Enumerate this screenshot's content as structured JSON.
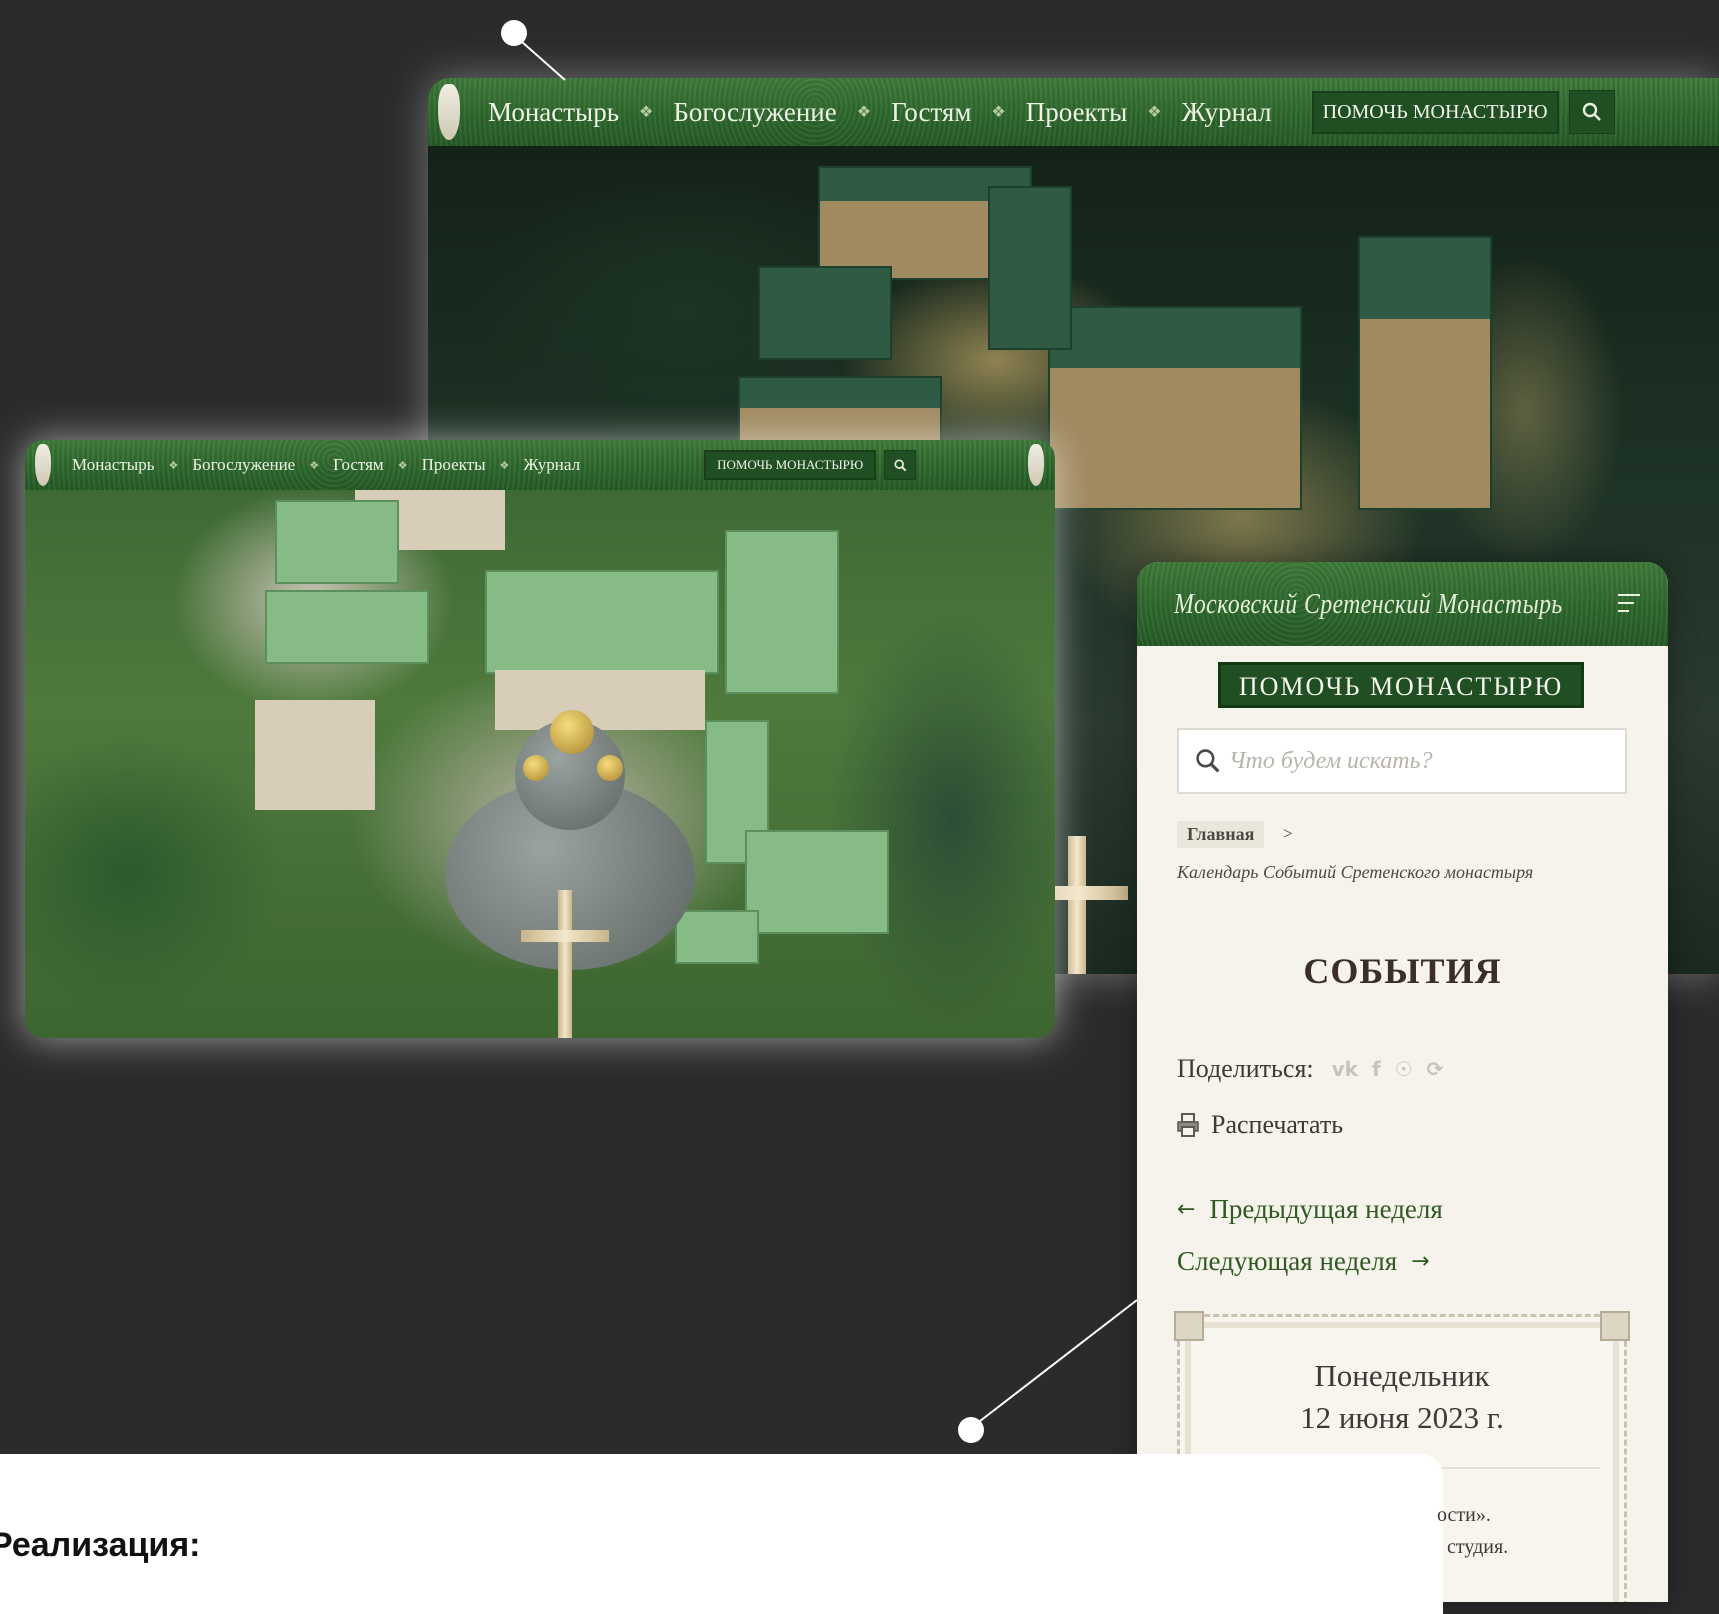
{
  "desktop_nav": {
    "items": [
      "Монастырь",
      "Богослужение",
      "Гостям",
      "Проекты",
      "Журнал"
    ],
    "help_label": "ПОМОЧЬ МОНАСТЫРЮ"
  },
  "mobile": {
    "site_title": "Московский Сретенский Монастырь",
    "help_label": "ПОМОЧЬ МОНАСТЫРЮ",
    "search_placeholder": "Что будем искать?",
    "breadcrumb_home": "Главная",
    "breadcrumb_sep": ">",
    "breadcrumb_current": "Календарь Событий Сретенского монастыря",
    "heading": "СОБЫТИЯ",
    "share_label": "Поделиться:",
    "share_icons": [
      "vk-icon",
      "facebook-icon",
      "odnoklassniki-icon",
      "telegram-icon"
    ],
    "print_label": "Распечатать",
    "prev_week": "Предыдущая неделя",
    "next_week": "Следующая неделя",
    "calendar_weekday": "Понедельник",
    "calendar_date": "12 июня 2023 г.",
    "peek_line1": "ости».",
    "peek_line2": "студия."
  },
  "bottom_card": {
    "title": "Реализация:"
  },
  "colors": {
    "nav_green": "#2f6a2e",
    "button_green": "#1f4f22",
    "link_green": "#2f5a21",
    "page_bg": "#2b2b2b"
  }
}
